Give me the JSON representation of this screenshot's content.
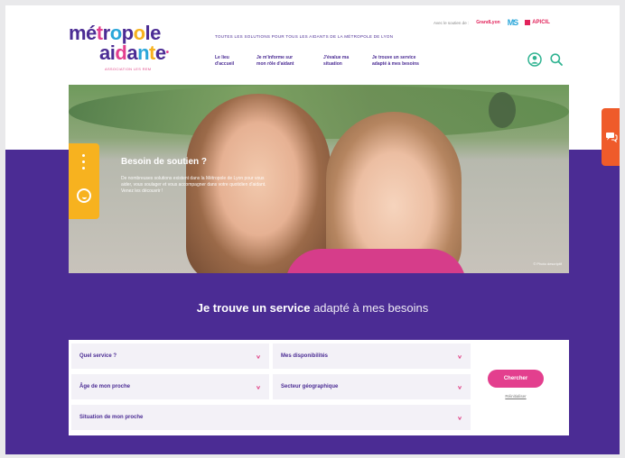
{
  "header": {
    "logo_line1": "métropole",
    "logo_line2": "aidante",
    "logo_sub": "ASSOCIATION LES REM",
    "tagline": "TOUTES LES SOLUTIONS POUR TOUS LES AIDANTS DE LA MÉTROPOLE DE LYON",
    "partners_label": "Avec le soutien de :",
    "partner_logos": [
      "GrandLyon",
      "MS",
      "APICIL"
    ],
    "nav": [
      {
        "label": "Le lieu d'accueil"
      },
      {
        "label": "Je m'informe sur mon rôle d'aidant"
      },
      {
        "label": "J'évalue ma situation"
      },
      {
        "label": "Je trouve un service adapté à mes besoins"
      }
    ],
    "icons": [
      "user-icon",
      "search-icon"
    ]
  },
  "hero": {
    "title": "Besoin de soutien ?",
    "description": "De nombreuses solutions existent dans la Métropole de Lyon pour vous aider, vous soulager et vous accompagner dans votre quotidien d'aidant. Venez les découvrir !",
    "credit": "© Photo descriptif"
  },
  "section": {
    "title_bold": "Je trouve un service",
    "title_light": "adapté à mes besoins"
  },
  "form": {
    "fields": [
      {
        "label": "Quel service ?"
      },
      {
        "label": "Mes disponibilités"
      },
      {
        "label": "Âge de mon proche"
      },
      {
        "label": "Secteur géographique"
      },
      {
        "label": "Situation de mon proche"
      }
    ],
    "submit_label": "Chercher",
    "reset_label": "Réinitialiser"
  },
  "colors": {
    "brand_purple": "#4b2c94",
    "accent_pink": "#e33f8e",
    "tab_yellow": "#f7b21f",
    "tab_orange": "#ef5b2a"
  }
}
